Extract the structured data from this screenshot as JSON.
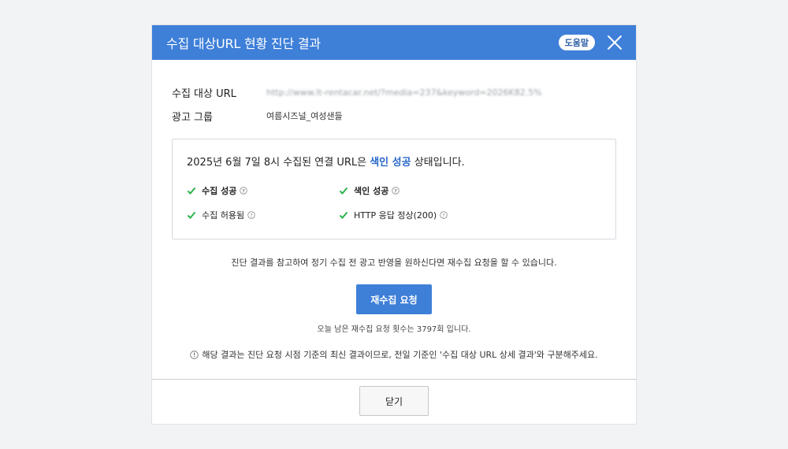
{
  "header": {
    "title": "수집 대상URL 현황 진단 결과",
    "help_label": "도움말"
  },
  "meta": {
    "url_label": "수집 대상 URL",
    "url_value": "http://www.lt-rentacar.net/?media=237&keyword=2026K82.5%",
    "group_label": "광고 그룹",
    "group_value": "여름시즈널_여성샌들"
  },
  "status": {
    "prefix": "2025년 6월 7일 8시 수집된 연결 URL은 ",
    "highlight": "색인 성공",
    "suffix": " 상태입니다.",
    "checks": [
      {
        "label": "수집 성공"
      },
      {
        "label": "색인 성공"
      },
      {
        "label": "수집 허용됨"
      },
      {
        "label": "HTTP 응답 정상(200)"
      }
    ]
  },
  "guide": "진단 결과를 참고하여 정기 수집 전 광고 반영을 원하신다면 재수집 요청을 할 수 있습니다.",
  "recrawl_label": "재수집 요청",
  "remain": "오늘 남은 재수집 요청 횟수는 3797회 입니다.",
  "notice": "해당 결과는 진단 요청 시점 기준의 최신 결과이므로, 전일 기준인 '수집 대상 URL 상세 결과'와 구분해주세요.",
  "footer": {
    "close_label": "닫기"
  },
  "colors": {
    "accent": "#3e7fd8",
    "highlight": "#2a68c8",
    "check": "#2bb34a"
  }
}
